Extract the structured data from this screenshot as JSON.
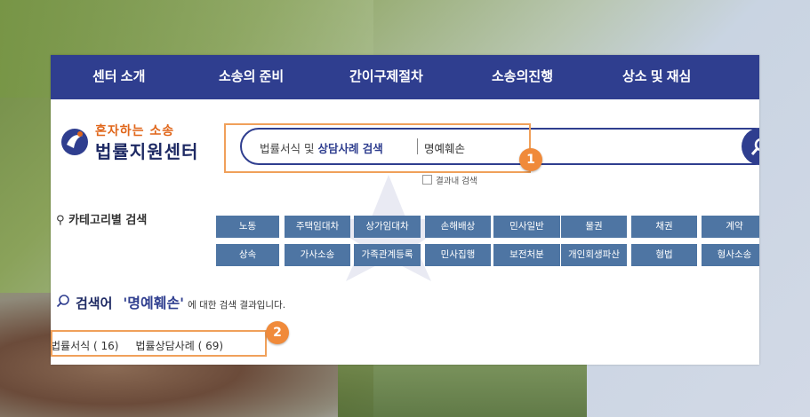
{
  "nav": {
    "items": [
      "센터 소개",
      "소송의 준비",
      "간이구제절차",
      "소송의진행",
      "상소 및 재심"
    ]
  },
  "logo": {
    "small": "혼자하는 소송",
    "big": "법률지원센터"
  },
  "search": {
    "hint_part1": "법률서식 및 ",
    "hint_part2": "상담사례 검색",
    "term": "명예훼손",
    "within_label": "결과내 검색"
  },
  "badges": {
    "one": "1",
    "two": "2"
  },
  "category": {
    "title": "카테고리별 검색",
    "row1": [
      "노동",
      "주택임대차",
      "상가임대차",
      "손해배상",
      "민사일반",
      "물권",
      "채권",
      "계약"
    ],
    "row2": [
      "상속",
      "가사소송",
      "가족관계등록",
      "민사집행",
      "보전처분",
      "개인회생파산",
      "형법",
      "형사소송"
    ]
  },
  "result": {
    "label": "검색어",
    "term": "'명예훼손'",
    "tail": "에 대한 검색 결과입니다."
  },
  "counts": {
    "forms": "법률서식 ( 16)",
    "cases": "법률상담사례 ( 69)"
  },
  "colors": {
    "nav": "#2f3e8f",
    "category_button": "#4e75a3",
    "highlight": "#f0a05a",
    "badge": "#f08a3a"
  }
}
